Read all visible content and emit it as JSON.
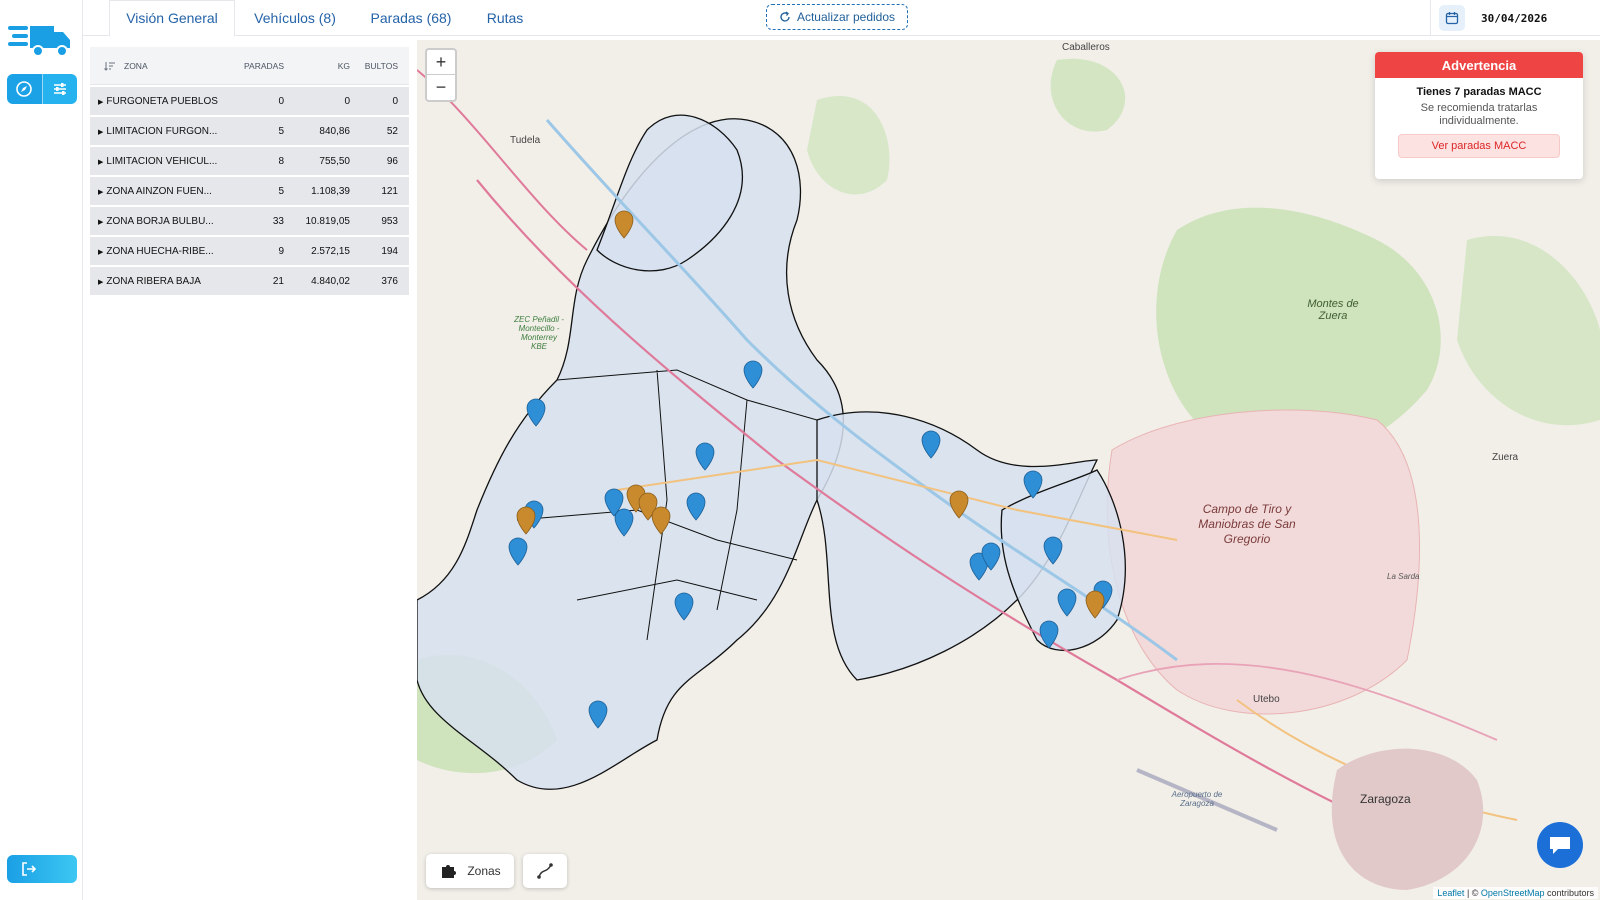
{
  "colors": {
    "accent": "#1aa1e6",
    "tab_text": "#2563a8",
    "warning": "#ef4444",
    "pin_blue": "#2f8fd6",
    "pin_orange": "#c98a2e"
  },
  "sidebar": {
    "logo": "delivery-truck-logo",
    "buttons": [
      "compass-icon",
      "sliders-icon"
    ],
    "logout_icon": "logout-icon"
  },
  "tabs": [
    {
      "label": "Visión General",
      "active": true
    },
    {
      "label": "Vehículos (8)",
      "active": false
    },
    {
      "label": "Paradas (68)",
      "active": false
    },
    {
      "label": "Rutas",
      "active": false
    }
  ],
  "refresh": {
    "label": "Actualizar pedidos"
  },
  "date": "30/04/2026",
  "zones": {
    "headers": {
      "zona": "ZONA",
      "paradas": "PARADAS",
      "kg": "KG",
      "bultos": "BULTOS"
    },
    "rows": [
      {
        "zona": "FURGONETA PUEBLOS",
        "paradas": "0",
        "kg": "0",
        "bultos": "0"
      },
      {
        "zona": "LIMITACION FURGON...",
        "paradas": "5",
        "kg": "840,86",
        "bultos": "52"
      },
      {
        "zona": "LIMITACION VEHICUL...",
        "paradas": "8",
        "kg": "755,50",
        "bultos": "96"
      },
      {
        "zona": "ZONA AINZON FUEN...",
        "paradas": "5",
        "kg": "1.108,39",
        "bultos": "121"
      },
      {
        "zona": "ZONA BORJA BULBU...",
        "paradas": "33",
        "kg": "10.819,05",
        "bultos": "953"
      },
      {
        "zona": "ZONA HUECHA-RIBE...",
        "paradas": "9",
        "kg": "2.572,15",
        "bultos": "194"
      },
      {
        "zona": "ZONA RIBERA BAJA",
        "paradas": "21",
        "kg": "4.840,02",
        "bultos": "376"
      }
    ]
  },
  "map": {
    "zoom_in": "+",
    "zoom_out": "−",
    "labels": {
      "tudela": "Tudela",
      "caballeros": "Caballeros",
      "montes": "Montes de Zuera",
      "campo": "Campo de Tiro y Maniobras de San Gregorio",
      "zaragoza": "Zaragoza",
      "zuera": "Zuera",
      "utebo": "Utebo",
      "aeropuerto": "Aeropuerto de Zaragoza",
      "zec": "ZEC Peñadil - Montecillo - Monterrey KBE",
      "la_sarda": "La Sarda"
    },
    "warning": {
      "header": "Advertencia",
      "title": "Tienes 7 paradas MACC",
      "text": "Se recomienda tratarlas individualmente.",
      "button": "Ver paradas MACC"
    },
    "tools": {
      "zones": "Zonas"
    },
    "attribution": {
      "leaflet": "Leaflet",
      "sep": " | © ",
      "osm": "OpenStreetMap",
      "tail": " contributors"
    }
  }
}
